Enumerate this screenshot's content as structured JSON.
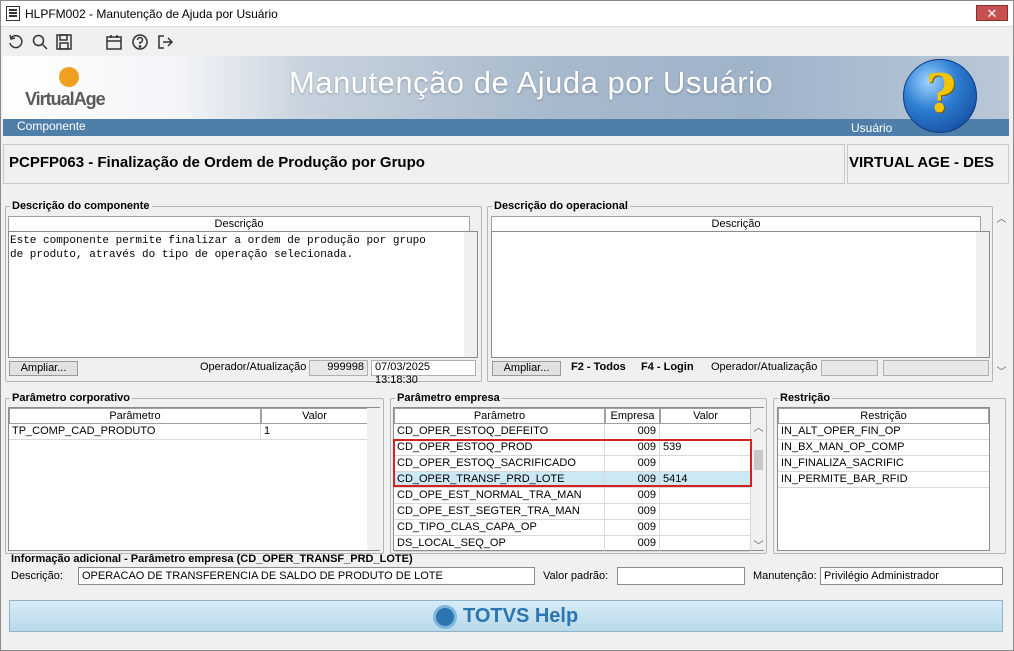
{
  "window": {
    "title": "HLPFM002 - Manutenção de Ajuda por Usuário",
    "close_label": "✕"
  },
  "toolbar": {
    "icons": [
      "refresh-icon",
      "search-icon",
      "save-icon",
      "calendar-icon",
      "help-icon",
      "exit-icon"
    ]
  },
  "banner": {
    "logo_text": "VirtualAge",
    "title": "Manutenção de Ajuda por Usuário",
    "componente_label": "Componente",
    "usuario_label": "Usuário",
    "help_glyph": "?"
  },
  "component": {
    "name": "PCPFP063 - Finalização de Ordem de Produção por Grupo",
    "user": "VIRTUAL AGE - DES"
  },
  "desc_componente": {
    "legend": "Descrição do componente",
    "column": "Descrição",
    "text": "Este componente permite finalizar a ordem de produção por grupo\nde produto, através do tipo de operação selecionada.",
    "ampliar": "Ampliar...",
    "oper_label": "Operador/Atualização",
    "operador": "999998",
    "data": "07/03/2025 13:18:30"
  },
  "desc_operacional": {
    "legend": "Descrição do operacional",
    "column": "Descrição",
    "ampliar": "Ampliar...",
    "f2": "F2 - Todos",
    "f4": "F4 - Login",
    "oper_label": "Operador/Atualização"
  },
  "param_corp": {
    "legend": "Parâmetro corporativo",
    "col_param": "Parâmetro",
    "col_valor": "Valor",
    "rows": [
      {
        "param": "TP_COMP_CAD_PRODUTO",
        "valor": "1"
      }
    ]
  },
  "param_emp": {
    "legend": "Parâmetro empresa",
    "col_param": "Parâmetro",
    "col_empresa": "Empresa",
    "col_valor": "Valor",
    "rows": [
      {
        "param": "CD_OPER_ESTOQ_DEFEITO",
        "empresa": "009",
        "valor": ""
      },
      {
        "param": "CD_OPER_ESTOQ_PROD",
        "empresa": "009",
        "valor": "539"
      },
      {
        "param": "CD_OPER_ESTOQ_SACRIFICADO",
        "empresa": "009",
        "valor": ""
      },
      {
        "param": "CD_OPER_TRANSF_PRD_LOTE",
        "empresa": "009",
        "valor": "5414"
      },
      {
        "param": "CD_OPE_EST_NORMAL_TRA_MAN",
        "empresa": "009",
        "valor": ""
      },
      {
        "param": "CD_OPE_EST_SEGTER_TRA_MAN",
        "empresa": "009",
        "valor": ""
      },
      {
        "param": "CD_TIPO_CLAS_CAPA_OP",
        "empresa": "009",
        "valor": ""
      },
      {
        "param": "DS_LOCAL_SEQ_OP",
        "empresa": "009",
        "valor": ""
      }
    ]
  },
  "restricao": {
    "legend": "Restrição",
    "column": "Restrição",
    "rows": [
      "IN_ALT_OPER_FIN_OP",
      "IN_BX_MAN_OP_COMP",
      "IN_FINALIZA_SACRIFIC",
      "IN_PERMITE_BAR_RFID"
    ]
  },
  "info": {
    "legend": "Informação adicional - Parâmetro empresa (CD_OPER_TRANSF_PRD_LOTE)",
    "descricao_label": "Descrição:",
    "descricao": "OPERACAO DE TRANSFERENCIA DE SALDO DE PRODUTO DE LOTE",
    "valor_padrao_label": "Valor padrão:",
    "valor_padrao": "",
    "manutencao_label": "Manutenção:",
    "manutencao": "Privilégio Administrador"
  },
  "footer": {
    "brand": "TOTVS Help"
  }
}
